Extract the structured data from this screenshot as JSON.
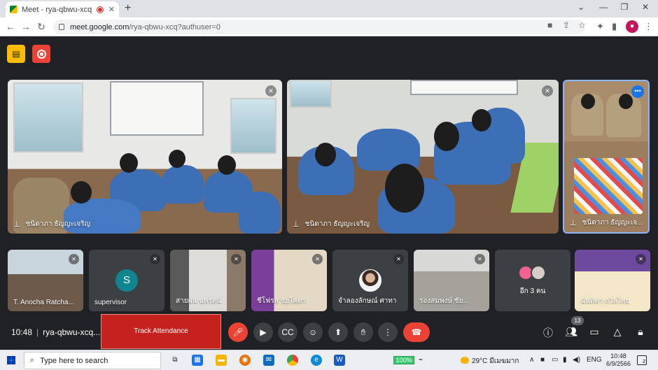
{
  "browser": {
    "tab_title": "Meet - rya-qbwu-xcq",
    "tab_close": "✕",
    "new_tab": "+",
    "url_host": "meet.google.com",
    "url_path": "/rya-qbwu-xcq?authuser=0",
    "profile_initial": "●"
  },
  "meeting": {
    "time": "10:48",
    "code": "rya-qbwu-xcq...",
    "track_attendance": "Track Attendance",
    "participant_count": "13"
  },
  "main_tiles": [
    {
      "name": "ชนิดาภา ธัญญะเจริญ"
    },
    {
      "name": "ชนิดาภา ธัญญะเจริญ"
    },
    {
      "name": "ชนิดาภา ธัญญะเจ..."
    }
  ],
  "filmstrip": [
    {
      "name": "T. Anocha Ratcha..."
    },
    {
      "name": "supervisor",
      "initial": "S"
    },
    {
      "name": "สายฝน นพรัตน์"
    },
    {
      "name": "ชีโฟรส ชัยโคตร"
    },
    {
      "name": "จำลองลักษณ์ ศาทา"
    },
    {
      "name": "รองสมพงษ์ ชัย..."
    },
    {
      "name": "อีก 3 คน"
    },
    {
      "name": "นันทิดา ถวิลไทย"
    }
  ],
  "taskbar": {
    "search_placeholder": "Type here to search",
    "battery": "100%",
    "weather": "29°C มีเมฆมาก",
    "lang": "ENG",
    "time": "10:48",
    "date": "6/9/2566",
    "notifications": "2"
  },
  "colors": {
    "meet_bg": "#202124",
    "end_call": "#ea4335",
    "track_button": "#c5221f",
    "active_speaker_border": "#8ab4f8",
    "avatar_supervisor": "#12848f"
  }
}
